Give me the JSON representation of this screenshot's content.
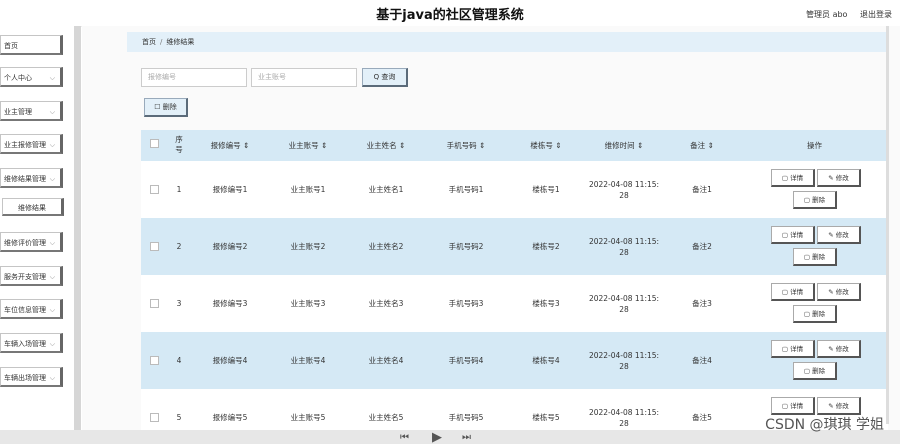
{
  "header": {
    "title": "基于java的社区管理系统",
    "user_name": "管理员 abo",
    "logout": "退出登录"
  },
  "sidebar": {
    "items": [
      {
        "label": "首页",
        "chev": ""
      },
      {
        "label": "个人中心",
        "chev": "⌵"
      },
      {
        "label": "业主管理",
        "chev": "⌵"
      },
      {
        "label": "业主报修管理",
        "chev": "⌵"
      },
      {
        "label": "维修结果管理",
        "chev": "⌵"
      },
      {
        "label": "维修评价管理",
        "chev": "⌵"
      },
      {
        "label": "服务开支管理",
        "chev": "⌵"
      },
      {
        "label": "车位信息管理",
        "chev": "⌵"
      },
      {
        "label": "车辆入场管理",
        "chev": "⌵"
      },
      {
        "label": "车辆出场管理",
        "chev": "⌵"
      }
    ],
    "sub_item": "维修结果"
  },
  "breadcrumb": {
    "home": "首页",
    "sep": "/",
    "current": "维修结果"
  },
  "search": {
    "repair_no_placeholder": "报修编号",
    "account_placeholder": "业主账号",
    "search_btn": "Q 查询"
  },
  "toolbar": {
    "delete_btn": "☐ 删除"
  },
  "table": {
    "headers": [
      "序号",
      "报修编号 ⇕",
      "业主账号 ⇕",
      "业主姓名 ⇕",
      "手机号码 ⇕",
      "楼栋号 ⇕",
      "维修时间 ⇕",
      "备注 ⇕",
      "操作"
    ],
    "index_header_top": "序",
    "index_header_bottom": "号",
    "rows": [
      {
        "index": "1",
        "repair_no": "报修编号1",
        "account": "业主账号1",
        "name": "业主姓名1",
        "phone": "手机号码1",
        "building": "楼栋号1",
        "time_a": "2022-04-08 11:15:",
        "time_b": "28",
        "note": "备注1"
      },
      {
        "index": "2",
        "repair_no": "报修编号2",
        "account": "业主账号2",
        "name": "业主姓名2",
        "phone": "手机号码2",
        "building": "楼栋号2",
        "time_a": "2022-04-08 11:15:",
        "time_b": "28",
        "note": "备注2"
      },
      {
        "index": "3",
        "repair_no": "报修编号3",
        "account": "业主账号3",
        "name": "业主姓名3",
        "phone": "手机号码3",
        "building": "楼栋号3",
        "time_a": "2022-04-08 11:15:",
        "time_b": "28",
        "note": "备注3"
      },
      {
        "index": "4",
        "repair_no": "报修编号4",
        "account": "业主账号4",
        "name": "业主姓名4",
        "phone": "手机号码4",
        "building": "楼栋号4",
        "time_a": "2022-04-08 11:15:",
        "time_b": "28",
        "note": "备注4"
      },
      {
        "index": "5",
        "repair_no": "报修编号5",
        "account": "业主账号5",
        "name": "业主姓名5",
        "phone": "手机号码5",
        "building": "楼栋号5",
        "time_a": "2022-04-08 11:15:",
        "time_b": "28",
        "note": "备注5"
      }
    ],
    "ops": {
      "detail": "▢ 详情",
      "edit": "✎ 修改",
      "delete": "▢ 删除"
    }
  },
  "watermark": "CSDN @琪琪 学姐"
}
